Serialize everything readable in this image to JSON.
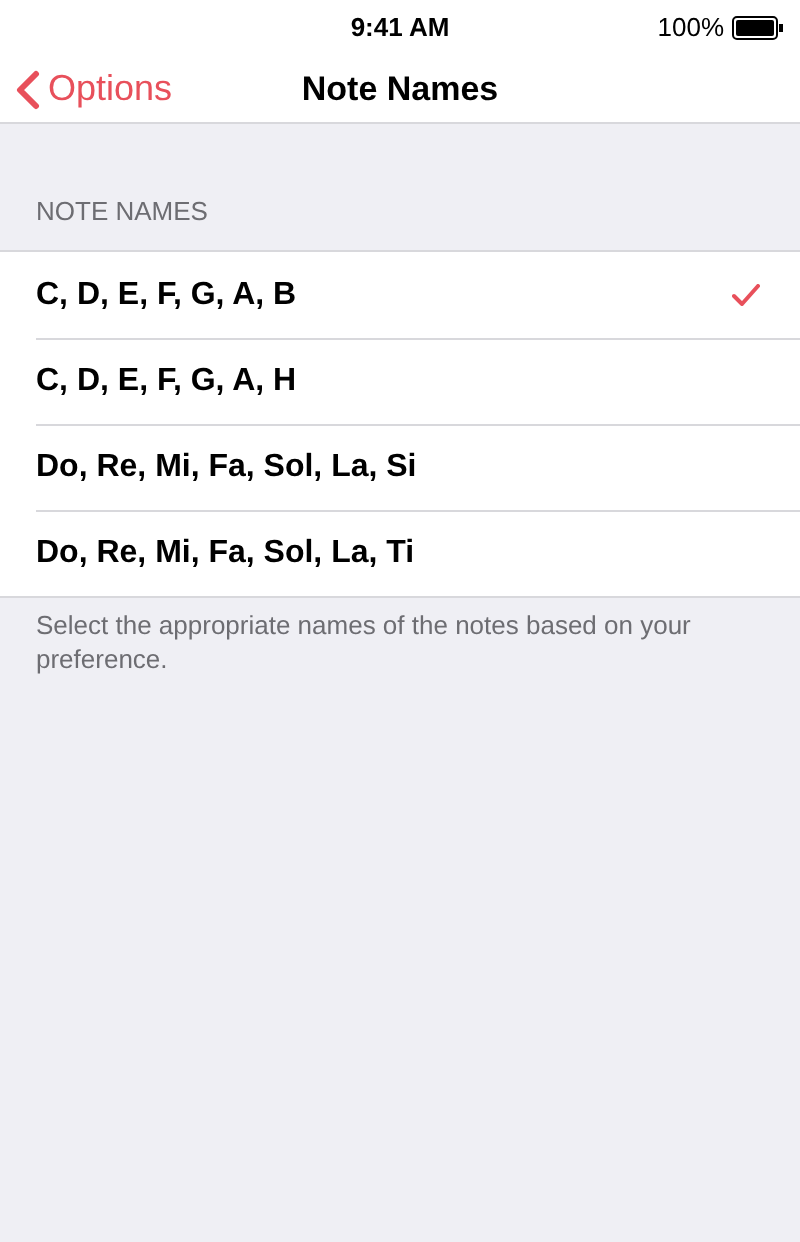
{
  "status_bar": {
    "time": "9:41 AM",
    "battery": "100%"
  },
  "nav": {
    "back": "Options",
    "title": "Note Names"
  },
  "section": {
    "header": "NOTE NAMES",
    "items": [
      {
        "label": "C, D, E, F, G, A, B",
        "selected": true
      },
      {
        "label": "C, D, E, F, G, A, H",
        "selected": false
      },
      {
        "label": "Do, Re, Mi, Fa, Sol, La, Si",
        "selected": false
      },
      {
        "label": "Do, Re, Mi, Fa, Sol, La, Ti",
        "selected": false
      }
    ],
    "footer": "Select the appropriate names of the notes based on your preference."
  }
}
